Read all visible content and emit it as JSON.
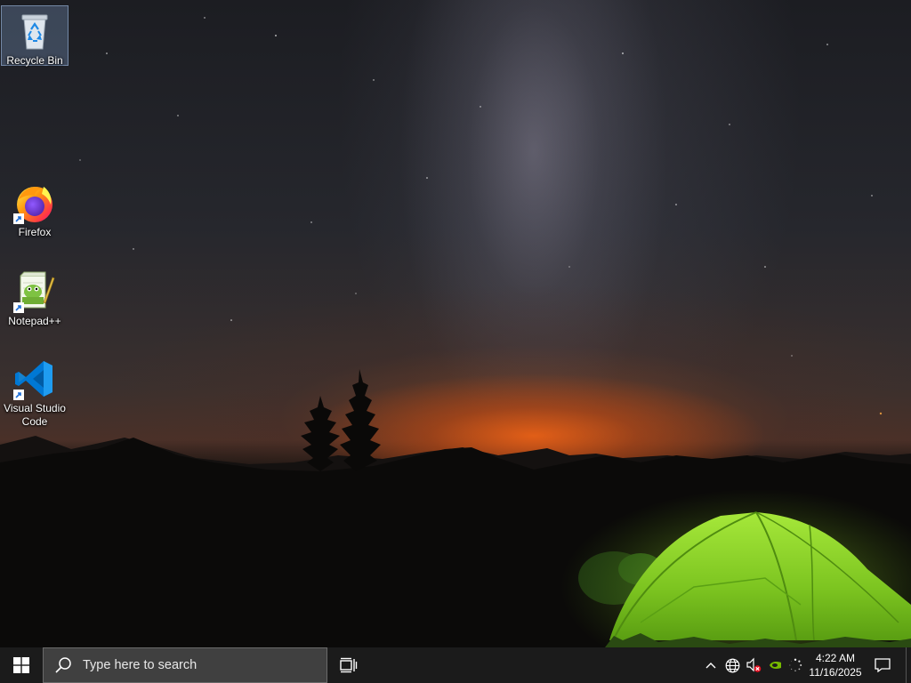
{
  "desktop": {
    "wallpaper": "night-sky-milky-way-camping-tent",
    "icons": [
      {
        "label": "Recycle Bin",
        "icon": "recycle-bin-icon"
      },
      {
        "label": "Firefox",
        "icon": "firefox-icon"
      },
      {
        "label": "Notepad++",
        "icon": "notepad-plus-plus-icon"
      },
      {
        "label": "Visual Studio Code",
        "icon": "vscode-icon"
      }
    ]
  },
  "taskbar": {
    "start_icon": "windows-logo-icon",
    "search": {
      "placeholder": "Type here to search",
      "icon": "search-icon"
    },
    "task_view_icon": "task-view-icon",
    "tray": {
      "chevron_icon": "chevron-up-icon",
      "network_icon": "globe-network-icon",
      "volume_icon": "speaker-muted-icon",
      "gpu_icon": "nvidia-icon",
      "loading_icon": "loading-spinner-icon"
    },
    "clock": {
      "time": "4:22 AM",
      "date": "11/16/2025"
    },
    "notification_icon": "action-center-icon"
  },
  "colors": {
    "taskbar_bg": "#1b1b1b",
    "search_bg": "#404040",
    "accent_blue": "#0078d4",
    "tent_green": "#7ed321"
  }
}
